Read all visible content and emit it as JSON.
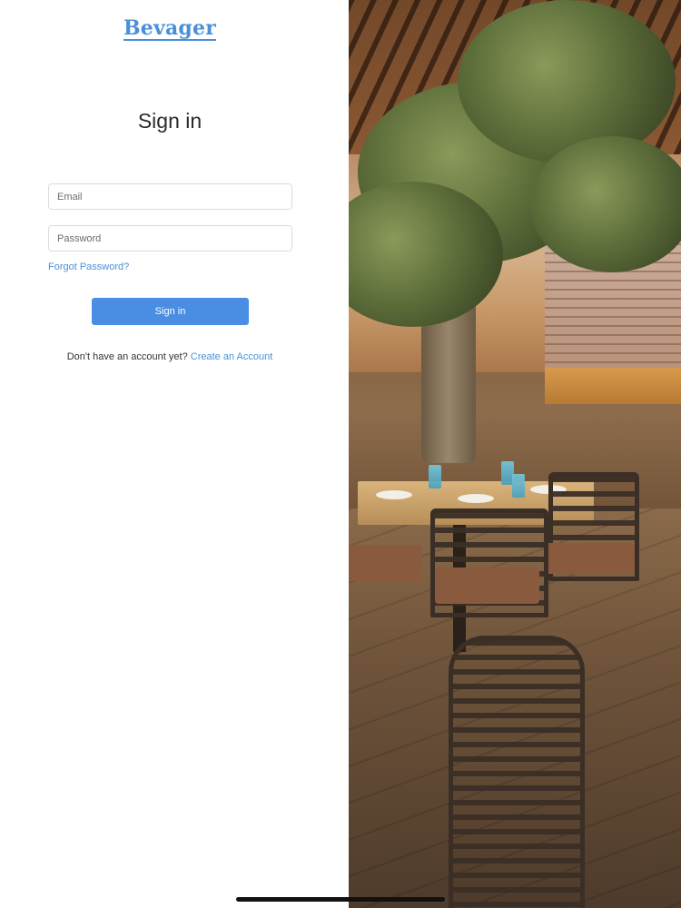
{
  "brand": {
    "logo_text": "Bevager",
    "color": "#4a90d9"
  },
  "login": {
    "title": "Sign in",
    "email_placeholder": "Email",
    "password_placeholder": "Password",
    "forgot_password": "Forgot Password?",
    "submit_label": "Sign in",
    "signup_prompt": "Don't have an account yet?",
    "signup_link": "Create an Account"
  },
  "colors": {
    "accent": "#4a8ee4",
    "link": "#4a90d9",
    "text": "#2b2b2b"
  }
}
